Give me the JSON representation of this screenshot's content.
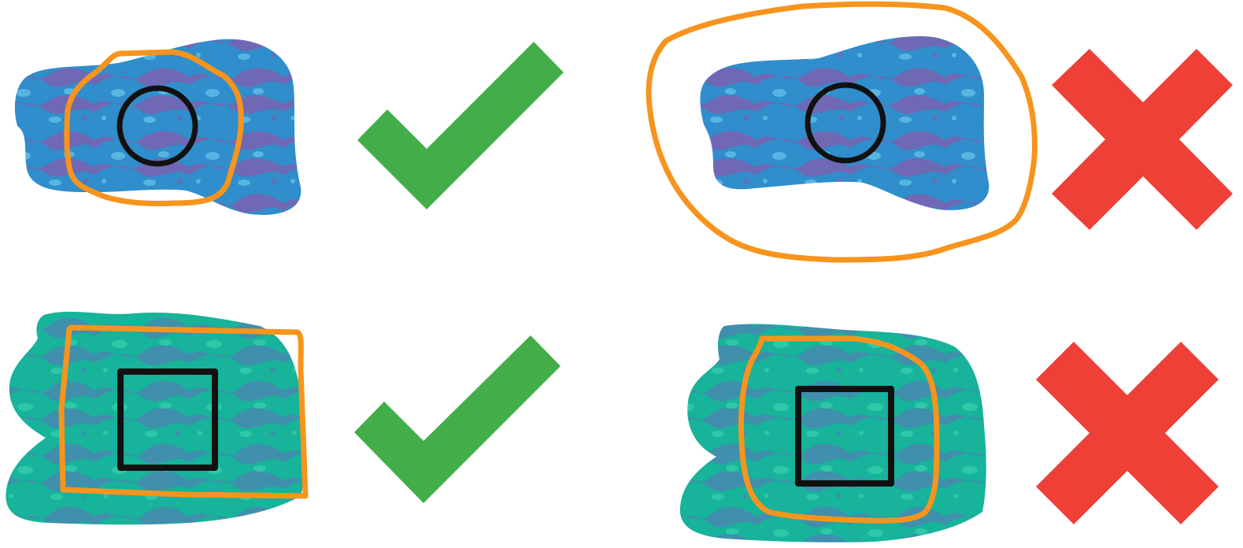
{
  "colors": {
    "background": "#ffffff",
    "blob_blue_base": "#2f8ecb",
    "blob_blue_pattern": "#6f68b4",
    "blob_blue_spot": "#58b5e2",
    "blob_green_base": "#17b39a",
    "blob_green_pattern": "#3f8fad",
    "blob_green_spot": "#2ec8a8",
    "selection_outline": "#f7941d",
    "target_outline": "#111111",
    "check": "#43ae49",
    "cross": "#ee4036"
  },
  "panels": [
    {
      "name": "top-left-example",
      "blob_style": "blue",
      "target_shape": "circle",
      "verdict": "correct",
      "verdict_icon": "check-icon"
    },
    {
      "name": "top-right-example",
      "blob_style": "blue",
      "target_shape": "circle",
      "verdict": "incorrect",
      "verdict_icon": "cross-icon"
    },
    {
      "name": "bottom-left-example",
      "blob_style": "green",
      "target_shape": "square",
      "verdict": "correct",
      "verdict_icon": "check-icon"
    },
    {
      "name": "bottom-right-example",
      "blob_style": "green",
      "target_shape": "square",
      "verdict": "incorrect",
      "verdict_icon": "cross-icon"
    }
  ]
}
